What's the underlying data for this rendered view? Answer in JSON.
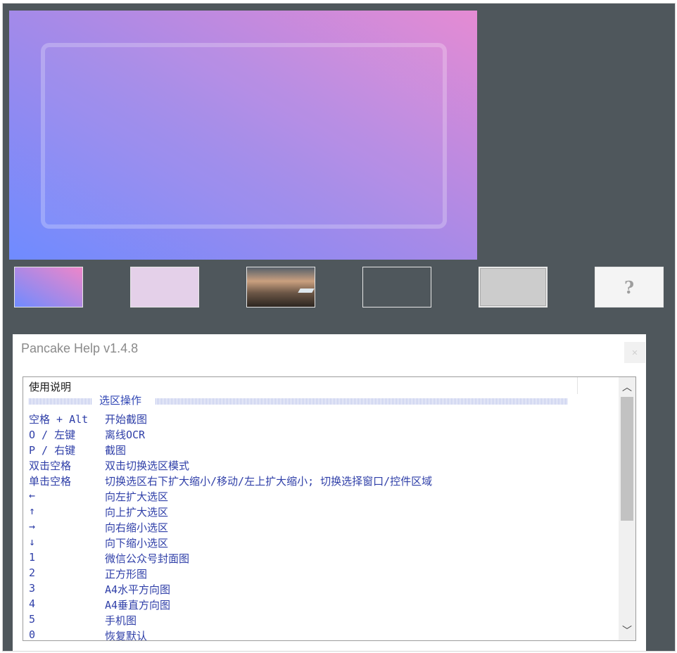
{
  "thumbnails": [
    {
      "name": "gradient-thumbnail",
      "bg": "#8a88f0"
    },
    {
      "name": "lavender-thumbnail",
      "bg": "#e4d0e9"
    },
    {
      "name": "landscape-photo-thumbnail",
      "bg": "#8a6b55"
    },
    {
      "name": "dark-thumbnail",
      "bg": "#4f575c"
    },
    {
      "name": "gray-thumbnail",
      "bg": "#cccccc"
    },
    {
      "name": "help-thumbnail",
      "label": "?"
    }
  ],
  "dialog": {
    "title": "Pancake Help v1.4.8",
    "close_icon": "close-icon",
    "header": "使用说明",
    "section_title": "选区操作",
    "rows": [
      {
        "key": "空格 + Alt",
        "desc": "开始截图"
      },
      {
        "key": "O / 左键",
        "desc": "离线OCR"
      },
      {
        "key": "P / 右键",
        "desc": "截图"
      },
      {
        "key": "双击空格",
        "desc": "双击切换选区模式"
      },
      {
        "key": "单击空格",
        "desc": "切换选区右下扩大缩小/移动/左上扩大缩小; 切换选择窗口/控件区域"
      },
      {
        "key": "←",
        "desc": "向左扩大选区"
      },
      {
        "key": "↑",
        "desc": "向上扩大选区"
      },
      {
        "key": "→",
        "desc": "向右缩小选区"
      },
      {
        "key": "↓",
        "desc": "向下缩小选区"
      },
      {
        "key": "1",
        "desc": "微信公众号封面图"
      },
      {
        "key": "2",
        "desc": "正方形图"
      },
      {
        "key": "3",
        "desc": "A4水平方向图"
      },
      {
        "key": "4",
        "desc": "A4垂直方向图"
      },
      {
        "key": "5",
        "desc": "手机图"
      },
      {
        "key": "0",
        "desc": "恢复默认"
      }
    ]
  },
  "scrollbar": {
    "up_icon": "chevron-up-icon",
    "down_icon": "chevron-down-icon"
  }
}
